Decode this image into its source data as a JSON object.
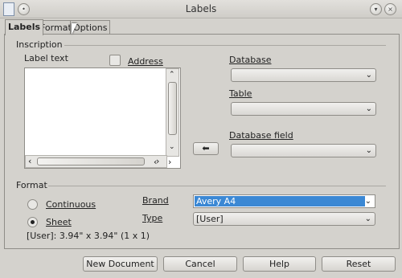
{
  "window": {
    "title": "Labels"
  },
  "tabs": [
    "Labels",
    "Format",
    "Options"
  ],
  "inscription": {
    "group_label": "Inscription",
    "label_text_label": "Label text",
    "address_label": "Address",
    "database_label": "Database",
    "table_label": "Table",
    "database_field_label": "Database field",
    "database_value": "",
    "table_value": "",
    "database_field_value": ""
  },
  "format": {
    "group_label": "Format",
    "continuous_label": "Continuous",
    "sheet_label": "Sheet",
    "selected": "Sheet",
    "brand_label": "Brand",
    "brand_value": "Avery A4",
    "type_label": "Type",
    "type_value": "[User]",
    "size_info": "[User]: 3.94\" x 3.94\" (1 x 1)"
  },
  "buttons": {
    "new_document": "New Document",
    "cancel": "Cancel",
    "help": "Help",
    "reset": "Reset"
  },
  "icons": {
    "arrow": "⬅",
    "chevron": "⌄"
  }
}
